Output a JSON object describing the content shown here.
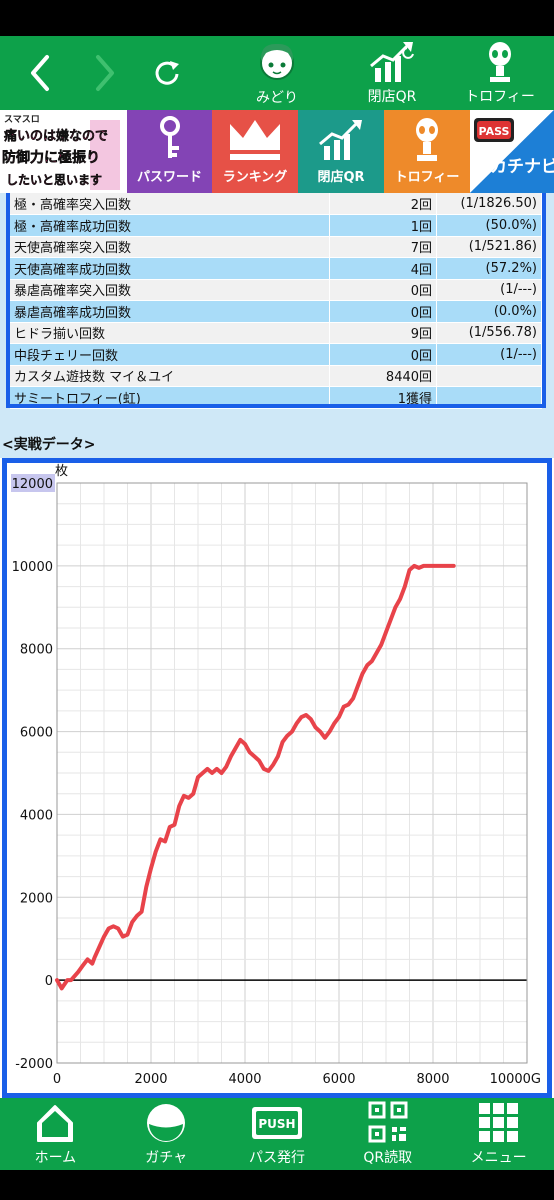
{
  "nav": {
    "midori": "みどり",
    "closing_qr": "閉店QR",
    "trophy": "トロフィー"
  },
  "banner": {
    "logo_lines": [
      "スマスロ",
      "痛いのは嫌なので",
      "防御力に極振り",
      "したいと思います"
    ],
    "password": "パスワード",
    "ranking": "ランキング",
    "closing_qr": "閉店QR",
    "trophy": "トロフィー",
    "pass_badge": "PASS",
    "kachinavi": "カチナビ"
  },
  "stats": {
    "rows": [
      {
        "label": "極・高確率突入回数",
        "count": "2回",
        "rate": "(1/1826.50)"
      },
      {
        "label": "極・高確率成功回数",
        "count": "1回",
        "rate": "(50.0%)"
      },
      {
        "label": "天使高確率突入回数",
        "count": "7回",
        "rate": "(1/521.86)"
      },
      {
        "label": "天使高確率成功回数",
        "count": "4回",
        "rate": "(57.2%)"
      },
      {
        "label": "暴虐高確率突入回数",
        "count": "0回",
        "rate": "(1/---)"
      },
      {
        "label": "暴虐高確率成功回数",
        "count": "0回",
        "rate": "(0.0%)"
      },
      {
        "label": "ヒドラ揃い回数",
        "count": "9回",
        "rate": "(1/556.78)"
      },
      {
        "label": "中段チェリー回数",
        "count": "0回",
        "rate": "(1/---)"
      },
      {
        "label": "カスタム遊技数 マイ＆ユイ",
        "count": "8440回",
        "rate": ""
      },
      {
        "label": "サミートロフィー(虹)",
        "count": "1獲得",
        "rate": ""
      }
    ]
  },
  "section_title": "<実戦データ>",
  "chart_data": {
    "type": "line",
    "ylabel": "枚",
    "xlim": [
      0,
      10000
    ],
    "ylim": [
      -2000,
      12000
    ],
    "x_ticks": [
      "0",
      "2000",
      "4000",
      "6000",
      "8000",
      "10000G"
    ],
    "y_ticks": [
      "-2000",
      "0",
      "2000",
      "4000",
      "6000",
      "8000",
      "10000",
      "12000"
    ],
    "grid": true,
    "line_color": "#e8434a",
    "series": [
      {
        "x": [
          0,
          100,
          220,
          300,
          450,
          550,
          650,
          750,
          800,
          900,
          1000,
          1100,
          1200,
          1300,
          1400,
          1500,
          1600,
          1700,
          1800,
          1900,
          2000,
          2100,
          2200,
          2300,
          2400,
          2500,
          2600,
          2700,
          2800,
          2900,
          3000,
          3100,
          3200,
          3300,
          3400,
          3500,
          3600,
          3700,
          3800,
          3900,
          4000,
          4100,
          4200,
          4300,
          4400,
          4500,
          4600,
          4700,
          4800,
          4900,
          5000,
          5100,
          5200,
          5300,
          5400,
          5500,
          5600,
          5700,
          5800,
          5900,
          6000,
          6100,
          6200,
          6300,
          6400,
          6500,
          6600,
          6700,
          6800,
          6900,
          7000,
          7100,
          7200,
          7300,
          7400,
          7500,
          7600,
          7700,
          7800,
          7900,
          8000,
          8100,
          8200,
          8300,
          8440
        ],
        "y": [
          0,
          -200,
          0,
          0,
          200,
          350,
          500,
          400,
          550,
          800,
          1050,
          1250,
          1300,
          1250,
          1050,
          1100,
          1400,
          1550,
          1650,
          2250,
          2700,
          3100,
          3400,
          3350,
          3700,
          3750,
          4200,
          4450,
          4400,
          4500,
          4900,
          5000,
          5100,
          5000,
          5100,
          5000,
          5150,
          5400,
          5600,
          5800,
          5700,
          5500,
          5400,
          5300,
          5100,
          5050,
          5200,
          5400,
          5750,
          5900,
          6000,
          6200,
          6350,
          6400,
          6300,
          6100,
          6000,
          5850,
          6000,
          6200,
          6350,
          6600,
          6650,
          6800,
          7100,
          7400,
          7600,
          7700,
          7900,
          8100,
          8400,
          8700,
          9000,
          9200,
          9500,
          9900,
          10000,
          9950,
          10000,
          10000,
          10000,
          10000,
          10000,
          10000,
          10000
        ]
      }
    ]
  },
  "bottom_nav": {
    "home": "ホーム",
    "gacha": "ガチャ",
    "pass_issue": "パス発行",
    "push_label": "PUSH",
    "qr_read": "QR読取",
    "menu": "メニュー"
  }
}
